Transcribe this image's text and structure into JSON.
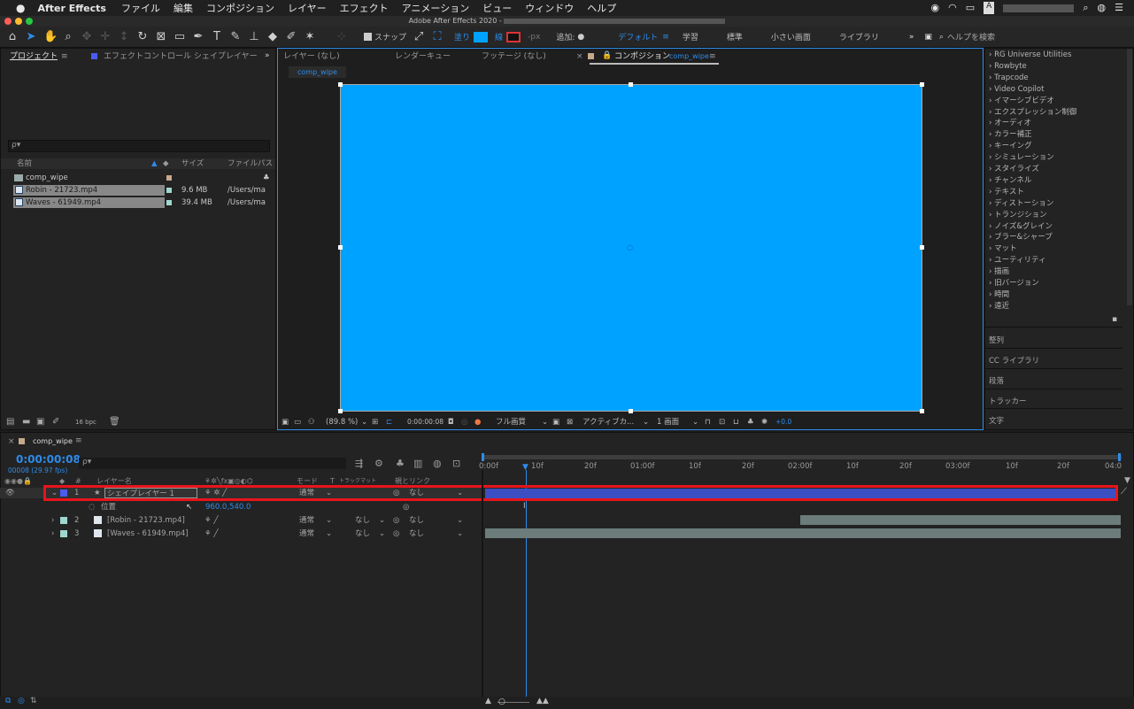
{
  "menubar": {
    "app": "After Effects",
    "items": [
      "ファイル",
      "編集",
      "コンポジション",
      "レイヤー",
      "エフェクト",
      "アニメーション",
      "ビュー",
      "ウィンドウ",
      "ヘルプ"
    ],
    "right_letter": "A"
  },
  "window_title": "Adobe After Effects 2020 -",
  "toolbar": {
    "snap": "スナップ",
    "fill": "塗り",
    "stroke": "線",
    "px": "-px",
    "add": "追加:",
    "workspace_default": "デフォルト",
    "workspace_learn": "学習",
    "workspace_standard": "標準",
    "workspace_small": "小さい画面",
    "workspace_library": "ライブラリ",
    "search_placeholder": "ヘルプを検索"
  },
  "project": {
    "tab": "プロジェクト",
    "tab2": "エフェクトコントロール シェイプレイヤー",
    "search": "ρ▾",
    "col_name": "名前",
    "col_size": "サイズ",
    "col_path": "ファイルパス",
    "items": [
      {
        "name": "comp_wipe",
        "size": "",
        "path": ""
      },
      {
        "name": "Robin - 21723.mp4",
        "size": "9.6 MB",
        "path": "/Users/ma"
      },
      {
        "name": "Waves - 61949.mp4",
        "size": "39.4 MB",
        "path": "/Users/ma"
      }
    ],
    "bpc": "16 bpc"
  },
  "viewer": {
    "tab_layer": "レイヤー (なし)",
    "tab_render": "レンダーキュー",
    "tab_footage": "フッテージ (なし)",
    "tab_comp": "コンポジション",
    "tab_comp_name": "comp_wipe",
    "subtab": "comp_wipe",
    "zoom": "(89.8 %)",
    "timecode": "0:00:00:08",
    "quality": "フル画質",
    "camera": "アクティブカ...",
    "views": "1 画面",
    "exposure": "+0.0"
  },
  "effects": {
    "items": [
      "RG Universe Utilities",
      "Rowbyte",
      "Trapcode",
      "Video Copilot",
      "イマーシブビデオ",
      "エクスプレッション制御",
      "オーディオ",
      "カラー補正",
      "キーイング",
      "シミュレーション",
      "スタイライズ",
      "チャンネル",
      "テキスト",
      "ディストーション",
      "トランジション",
      "ノイズ&グレイン",
      "ブラー&シャープ",
      "マット",
      "ユーティリティ",
      "描画",
      "旧バージョン",
      "時間",
      "遠近"
    ],
    "panels": [
      "整列",
      "CC ライブラリ",
      "段落",
      "トラッカー",
      "文字"
    ]
  },
  "timeline": {
    "tab": "comp_wipe",
    "timecode": "0:00:00:08",
    "frames": "00008 (29.97 fps)",
    "search": "ρ▾",
    "col_layer": "レイヤー名",
    "col_mode": "モード",
    "col_t": "T",
    "col_trkmat": "トラックマット",
    "col_parent": "親とリンク",
    "ruler": [
      "0:00f",
      "10f",
      "20f",
      "01:00f",
      "10f",
      "20f",
      "02:00f",
      "10f",
      "20f",
      "03:00f",
      "10f",
      "20f",
      "04:0"
    ],
    "layers": [
      {
        "num": "1",
        "name": "シェイプレイヤー 1",
        "mode": "通常",
        "trk": "",
        "parent": "なし"
      },
      {
        "num": "2",
        "name": "[Robin - 21723.mp4]",
        "mode": "通常",
        "trk": "なし",
        "parent": "なし"
      },
      {
        "num": "3",
        "name": "[Waves - 61949.mp4]",
        "mode": "通常",
        "trk": "なし",
        "parent": "なし"
      }
    ],
    "prop_name": "位置",
    "prop_value": "960.0,540.0"
  },
  "colors": {
    "comp_bg": "#00a2ff",
    "accent": "#2d8ceb",
    "layer1_bar": "#3c4fc2",
    "layer_bar": "#6b7c7b",
    "highlight": "#e8141c"
  }
}
